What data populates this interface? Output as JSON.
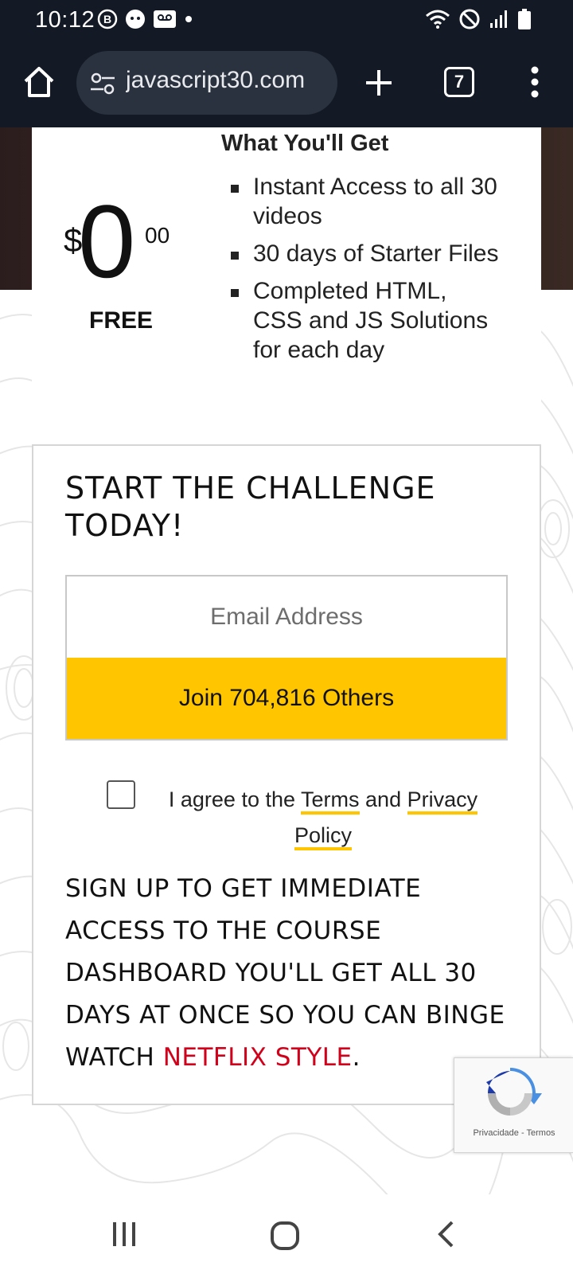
{
  "status_bar": {
    "time": "10:12",
    "left_icons": [
      "b-badge-icon",
      "face-notification-icon",
      "voicemail-icon",
      "dot-icon"
    ],
    "right_icons": [
      "wifi-icon",
      "do-not-disturb-icon",
      "signal-icon",
      "battery-icon"
    ]
  },
  "browser": {
    "url": "javascript30.com",
    "tab_count": "7"
  },
  "card": {
    "get_title": "What You'll Get",
    "price_currency": "$",
    "price_main": "0",
    "price_cents": "00",
    "price_label": "FREE",
    "features": [
      "Instant Access to all 30 videos",
      "30 days of Starter Files",
      "Completed HTML, CSS and JS Solutions for each day"
    ]
  },
  "signup": {
    "title": "START THE CHALLENGE TODAY!",
    "email_placeholder": "Email Address",
    "join_label": "Join 704,816 Others",
    "agree_prefix": "I agree to the ",
    "terms_link": "Terms",
    "agree_and": " and ",
    "privacy_link": "Privacy Policy",
    "message_main": "SIGN UP TO GET IMMEDIATE ACCESS TO THE COURSE DASHBOARD YOU'LL GET ALL 30 DAYS AT ONCE SO YOU CAN BINGE WATCH ",
    "message_highlight": "NETFLIX STYLE",
    "message_end": "."
  },
  "recaptcha": {
    "privacy": "Privacidade",
    "separator": " - ",
    "terms": "Termos"
  },
  "colors": {
    "accent_yellow": "#ffc600",
    "netflix_red": "#d0021b",
    "chrome_dark": "#131a25"
  }
}
